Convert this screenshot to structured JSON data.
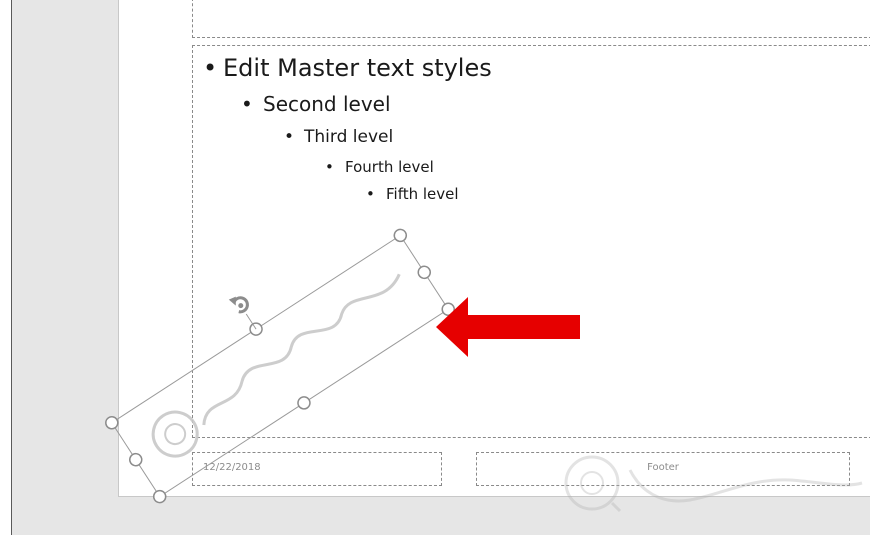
{
  "slide": {
    "body_levels": [
      {
        "bullet": "•",
        "text": "Edit Master text styles"
      },
      {
        "bullet": "•",
        "text": "Second level"
      },
      {
        "bullet": "•",
        "text": "Third level"
      },
      {
        "bullet": "•",
        "text": "Fourth level"
      },
      {
        "bullet": "•",
        "text": "Fifth level"
      }
    ],
    "date": "12/22/2018",
    "footer": "Footer"
  },
  "selected_shape": {
    "rotation_degrees": -33,
    "rotate_handle_icon": "rotate-icon"
  },
  "annotation": {
    "arrow_icon": "arrow-left-icon",
    "arrow_color": "#e60000"
  },
  "colors": {
    "workspace": "#e6e6e6",
    "slide": "#ffffff",
    "placeholder_border": "#8a8a8a",
    "handle": "#8c8c8c"
  }
}
